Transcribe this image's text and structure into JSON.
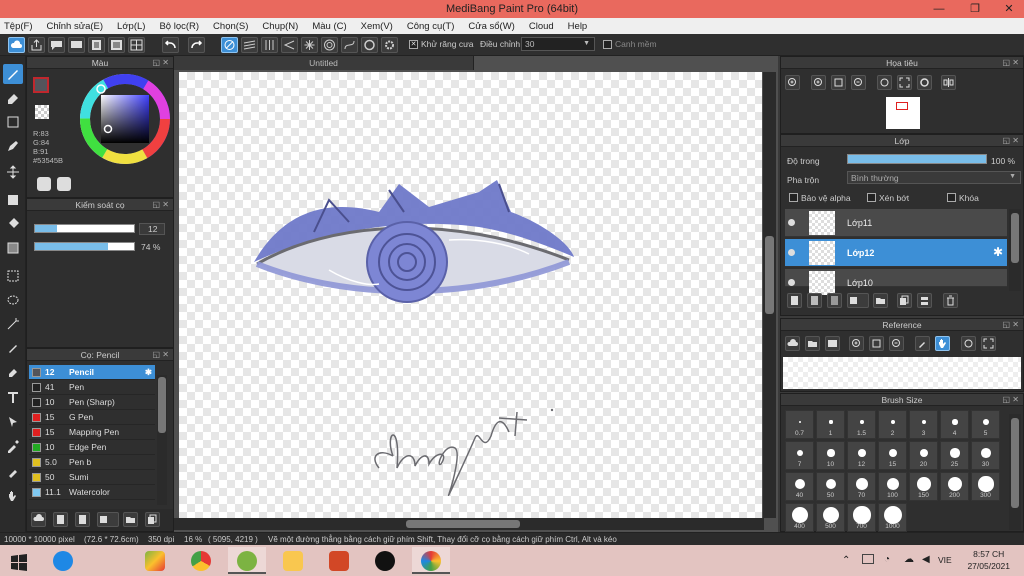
{
  "window": {
    "title": "MediBang Paint Pro (64bit)",
    "minimize": "—",
    "maximize": "❐",
    "close": "✕"
  },
  "menu": [
    "Tệp(F)",
    "Chỉnh sửa(E)",
    "Lớp(L)",
    "Bộ lọc(R)",
    "Chọn(S)",
    "Chụp(N)",
    "Màu (C)",
    "Xem(V)",
    "Công cụ(T)",
    "Cửa sổ(W)",
    "Cloud",
    "Help"
  ],
  "toolbar": {
    "antialias_label": "Khử răng cưa",
    "correction_label": "Điều chỉnh",
    "correction_value": "30",
    "snap_edge_label": "Canh mềm",
    "check_mark": "✕"
  },
  "color_panel": {
    "title": "Màu",
    "r": "R:83",
    "g": "G:84",
    "b": "B:91",
    "hex": "#53545B",
    "primary_color": "#53545b",
    "accent_color": "#c0272d"
  },
  "brush_control": {
    "title": "Kiểm soát cọ",
    "size_value": "12",
    "opacity_value": "74 %",
    "size_fraction": 0.22,
    "opacity_fraction": 0.74
  },
  "brush_list": {
    "title": "Cọ: Pencil",
    "items": [
      {
        "size": "12",
        "name": "Pencil",
        "color": "#53545b",
        "selected": true
      },
      {
        "size": "41",
        "name": "Pen",
        "color": "#222222"
      },
      {
        "size": "10",
        "name": "Pen (Sharp)",
        "color": "#222222"
      },
      {
        "size": "15",
        "name": "G Pen",
        "color": "#e02020"
      },
      {
        "size": "15",
        "name": "Mapping Pen",
        "color": "#e02020"
      },
      {
        "size": "10",
        "name": "Edge Pen",
        "color": "#22aa22"
      },
      {
        "size": "5.0",
        "name": "Pen b",
        "color": "#e0c020"
      },
      {
        "size": "50",
        "name": "Sumi",
        "color": "#e0c020"
      },
      {
        "size": "11.1",
        "name": "Watercolor",
        "color": "#7fc8f0"
      }
    ]
  },
  "document": {
    "tab": "Untitled"
  },
  "navigator": {
    "title": "Họa tiêu"
  },
  "layer_panel": {
    "title": "Lớp",
    "opacity_label": "Độ trong",
    "opacity_value": "100 %",
    "opacity_fraction": 1.0,
    "blend_label": "Pha trộn",
    "blend_value": "Bình thường",
    "protect_alpha": "Bảo vệ alpha",
    "clipping": "Xén bớt",
    "lock": "Khóa",
    "layers": [
      {
        "name": "Lớp11",
        "selected": false
      },
      {
        "name": "Lớp12",
        "selected": true
      },
      {
        "name": "Lớp10",
        "selected": false
      }
    ]
  },
  "reference_panel": {
    "title": "Reference"
  },
  "brush_size_panel": {
    "title": "Brush Size",
    "sizes": [
      "0.7",
      "1",
      "1.5",
      "2",
      "3",
      "4",
      "5",
      "7",
      "10",
      "12",
      "15",
      "20",
      "25",
      "30",
      "40",
      "50",
      "70",
      "100",
      "150",
      "200",
      "300",
      "400",
      "500",
      "700",
      "1000"
    ]
  },
  "status": {
    "dimensions": "10000 * 10000 pixel",
    "physical": "(72.6 * 72.6cm)",
    "dpi": "350 dpi",
    "zoom": "16 %",
    "coords": "( 5095, 4219 )",
    "hint": "Vẽ một đường thẳng bằng cách giữ phím Shift, Thay đổi cỡ cọ bằng cách giữ phím Ctrl, Alt và kéo"
  },
  "taskbar": {
    "lang": "VIE",
    "time": "8:57 CH",
    "date": "27/05/2021"
  }
}
